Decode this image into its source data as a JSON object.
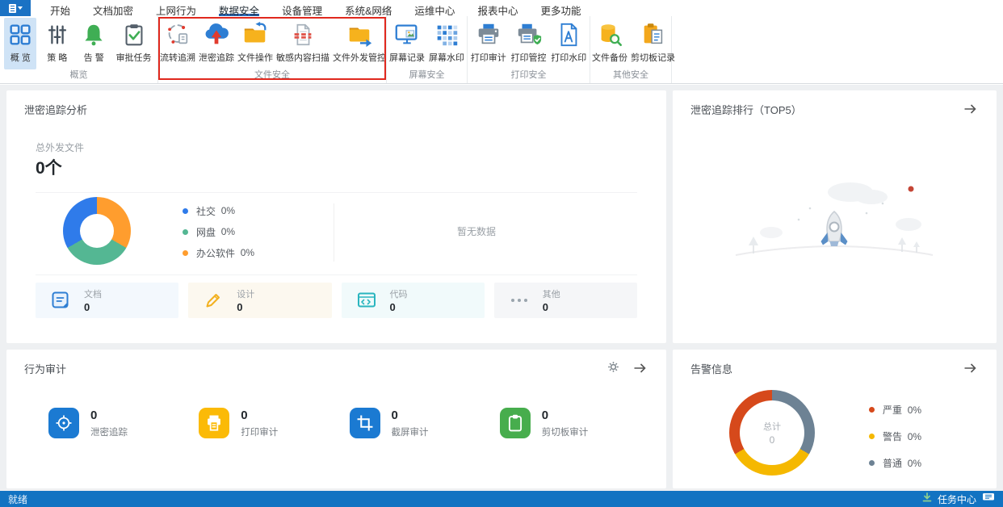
{
  "menu": {
    "tabs": [
      {
        "label": "开始"
      },
      {
        "label": "文档加密"
      },
      {
        "label": "上网行为"
      },
      {
        "label": "数据安全",
        "active": true
      },
      {
        "label": "设备管理"
      },
      {
        "label": "系统&网络"
      },
      {
        "label": "运维中心"
      },
      {
        "label": "报表中心"
      },
      {
        "label": "更多功能"
      }
    ]
  },
  "ribbon": {
    "groups": [
      {
        "label": "概览",
        "items": [
          {
            "label": "概 览",
            "icon": "overview-grid-icon",
            "selected": true
          },
          {
            "label": "策 略",
            "icon": "sliders-icon"
          },
          {
            "label": "告 警",
            "icon": "bell-icon"
          },
          {
            "label": "审批任务",
            "icon": "clipboard-check-icon"
          }
        ]
      },
      {
        "label": "文件安全",
        "highlighted_by_red_box": true,
        "items": [
          {
            "label": "流转追溯",
            "icon": "circulation-icon"
          },
          {
            "label": "泄密追踪",
            "icon": "cloud-upload-icon"
          },
          {
            "label": "文件操作",
            "icon": "folder-return-icon"
          },
          {
            "label": "敏感内容扫描",
            "icon": "scan-document-icon"
          },
          {
            "label": "文件外发管控",
            "icon": "folder-export-icon"
          }
        ]
      },
      {
        "label": "屏幕安全",
        "items": [
          {
            "label": "屏幕记录",
            "icon": "screen-record-icon"
          },
          {
            "label": "屏幕水印",
            "icon": "screen-watermark-icon"
          }
        ]
      },
      {
        "label": "打印安全",
        "items": [
          {
            "label": "打印审计",
            "icon": "printer-icon"
          },
          {
            "label": "打印管控",
            "icon": "printer-shield-icon"
          },
          {
            "label": "打印水印",
            "icon": "document-a-icon"
          }
        ]
      },
      {
        "label": "其他安全",
        "items": [
          {
            "label": "文件备份",
            "icon": "database-search-icon"
          },
          {
            "label": "剪切板记录",
            "icon": "clipboard-doc-icon"
          }
        ]
      }
    ]
  },
  "panels": {
    "trace_analysis": {
      "title": "泄密追踪分析",
      "total_label": "总外发文件",
      "total_value": "0个",
      "no_data": "暂无数据",
      "cards": [
        {
          "label": "文档",
          "value": "0",
          "icon": "document-icon"
        },
        {
          "label": "设计",
          "value": "0",
          "icon": "pencil-icon"
        },
        {
          "label": "代码",
          "value": "0",
          "icon": "code-window-icon"
        },
        {
          "label": "其他",
          "value": "0",
          "icon": "ellipsis-icon"
        }
      ]
    },
    "trace_ranking": {
      "title": "泄密追踪排行（TOP5）"
    },
    "behavior_audit": {
      "title": "行为审计",
      "items": [
        {
          "value": "0",
          "label": "泄密追踪",
          "icon": "target-icon",
          "color": "#1b7ad2"
        },
        {
          "value": "0",
          "label": "打印审计",
          "icon": "printer-icon",
          "color": "#fbba07"
        },
        {
          "value": "0",
          "label": "截屏审计",
          "icon": "crop-icon",
          "color": "#1b7ad2"
        },
        {
          "value": "0",
          "label": "剪切板审计",
          "icon": "clipboard-icon",
          "color": "#47ad4d"
        }
      ]
    },
    "alerts": {
      "title": "告警信息"
    }
  },
  "chart_data": [
    {
      "type": "pie",
      "title": "泄密追踪分析 外发渠道占比",
      "categories": [
        "社交",
        "网盘",
        "办公软件"
      ],
      "values": [
        0,
        0,
        0
      ],
      "percent_labels": [
        "0%",
        "0%",
        "0%"
      ],
      "colors": [
        "#2f7bea",
        "#54b793",
        "#ff9d2e"
      ],
      "legend_position": "right",
      "donut": true
    },
    {
      "type": "pie",
      "title": "告警信息",
      "categories": [
        "严重",
        "警告",
        "普通"
      ],
      "values": [
        0,
        0,
        0
      ],
      "percent_labels": [
        "0%",
        "0%",
        "0%"
      ],
      "colors": [
        "#d6491b",
        "#f5b800",
        "#6d8294"
      ],
      "center_label": "总计",
      "center_value": "0",
      "legend_position": "right",
      "donut": true
    }
  ],
  "status_bar": {
    "left": "就绪",
    "task_center": "任务中心"
  },
  "colors": {
    "accent": "#2e7ed3",
    "menubar_button": "#1a72c4",
    "active_tab_underline": "#2a6cbe",
    "ribbon_selected_bg": "#cfe3f6",
    "red_highlight_box": "#e0281e",
    "content_bg": "#eef0f2",
    "statusbar_bg": "#1273c2"
  }
}
